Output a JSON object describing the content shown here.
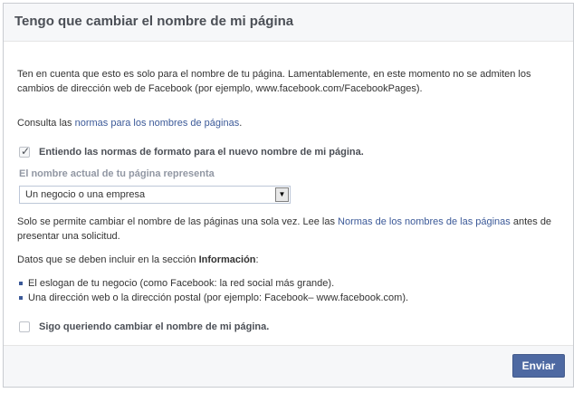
{
  "dialog": {
    "title": "Tengo que cambiar el nombre de mi página",
    "intro": "Ten en cuenta que esto es solo para el nombre de tu página. Lamentablemente, en este momento no se admiten los cambios de dirección web de Facebook (por ejemplo, www.facebook.com/FacebookPages).",
    "consult_prefix": "Consulta las ",
    "consult_link": "normas para los nombres de páginas",
    "consult_suffix": ".",
    "checkbox1": {
      "label": "Entiendo las normas de formato para el nuevo nombre de mi página.",
      "checked": true
    },
    "represents_label": "El nombre actual de tu página representa",
    "select": {
      "value": "Un negocio o una empresa"
    },
    "once_prefix": "Solo se permite cambiar el nombre de las páginas una sola vez. Lee las ",
    "once_link": "Normas de los nombres de las páginas",
    "once_suffix": " antes de presentar una solicitud.",
    "info_prefix": "Datos que se deben incluir en la sección ",
    "info_bold": "Información",
    "info_suffix": ":",
    "bullets": [
      "El eslogan de tu negocio (como Facebook: la red social más grande).",
      "Una dirección web o la dirección postal (por ejemplo: Facebook– www.facebook.com)."
    ],
    "checkbox2": {
      "label": "Sigo queriendo cambiar el nombre de mi página.",
      "checked": false
    },
    "submit_label": "Enviar"
  },
  "colors": {
    "link": "#3b5998",
    "button": "#4e69a2",
    "header_bg": "#f6f7f9"
  }
}
